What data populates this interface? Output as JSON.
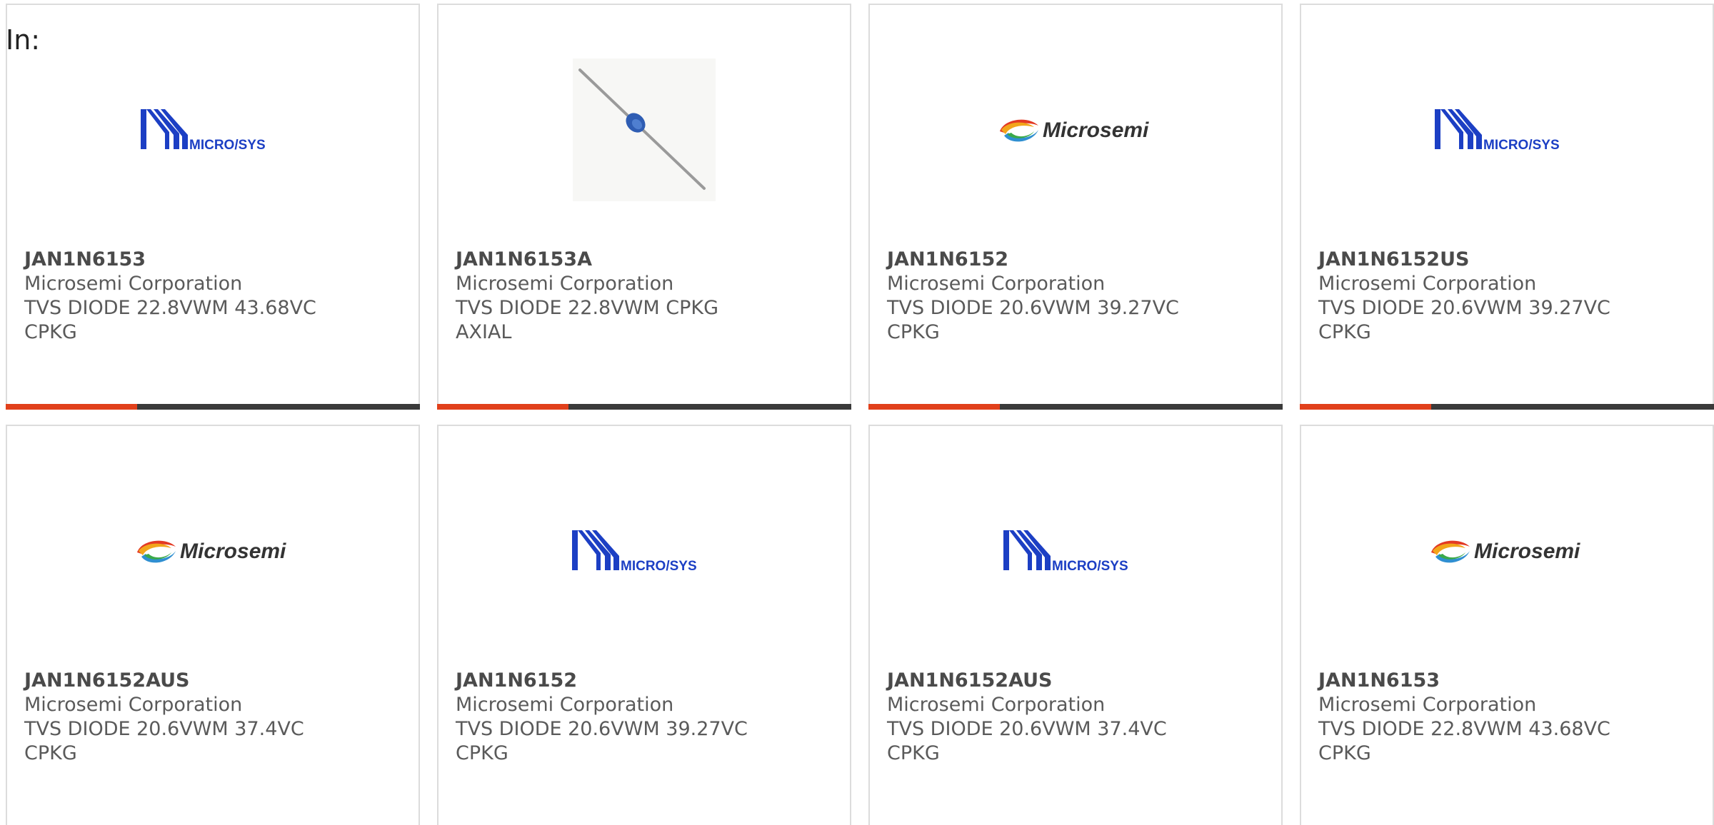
{
  "heading": "In:",
  "colors": {
    "accent": "#e1401b",
    "bar_dark": "#3a3a3a",
    "card_border": "#dcdcdc",
    "microsys_blue": "#1c3fc4"
  },
  "products": [
    {
      "part": "JAN1N6153",
      "manufacturer": "Microsemi Corporation",
      "description": "TVS DIODE 22.8VWM 43.68VC CPKG",
      "image": "microsys-logo",
      "logo_text": "MICRO/SYS"
    },
    {
      "part": "JAN1N6153A",
      "manufacturer": "Microsemi Corporation",
      "description": "TVS DIODE 22.8VWM CPKG AXIAL",
      "image": "axial-diode-photo"
    },
    {
      "part": "JAN1N6152",
      "manufacturer": "Microsemi Corporation",
      "description": "TVS DIODE 20.6VWM 39.27VC CPKG",
      "image": "microsemi-logo",
      "logo_text": "Microsemi"
    },
    {
      "part": "JAN1N6152US",
      "manufacturer": "Microsemi Corporation",
      "description": "TVS DIODE 20.6VWM 39.27VC CPKG",
      "image": "microsys-logo",
      "logo_text": "MICRO/SYS"
    },
    {
      "part": "JAN1N6152AUS",
      "manufacturer": "Microsemi Corporation",
      "description": "TVS DIODE 20.6VWM 37.4VC CPKG",
      "image": "microsemi-logo",
      "logo_text": "Microsemi"
    },
    {
      "part": "JAN1N6152",
      "manufacturer": "Microsemi Corporation",
      "description": "TVS DIODE 20.6VWM 39.27VC CPKG",
      "image": "microsys-logo",
      "logo_text": "MICRO/SYS"
    },
    {
      "part": "JAN1N6152AUS",
      "manufacturer": "Microsemi Corporation",
      "description": "TVS DIODE 20.6VWM 37.4VC CPKG",
      "image": "microsys-logo",
      "logo_text": "MICRO/SYS"
    },
    {
      "part": "JAN1N6153",
      "manufacturer": "Microsemi Corporation",
      "description": "TVS DIODE 22.8VWM 43.68VC CPKG",
      "image": "microsemi-logo",
      "logo_text": "Microsemi"
    }
  ]
}
